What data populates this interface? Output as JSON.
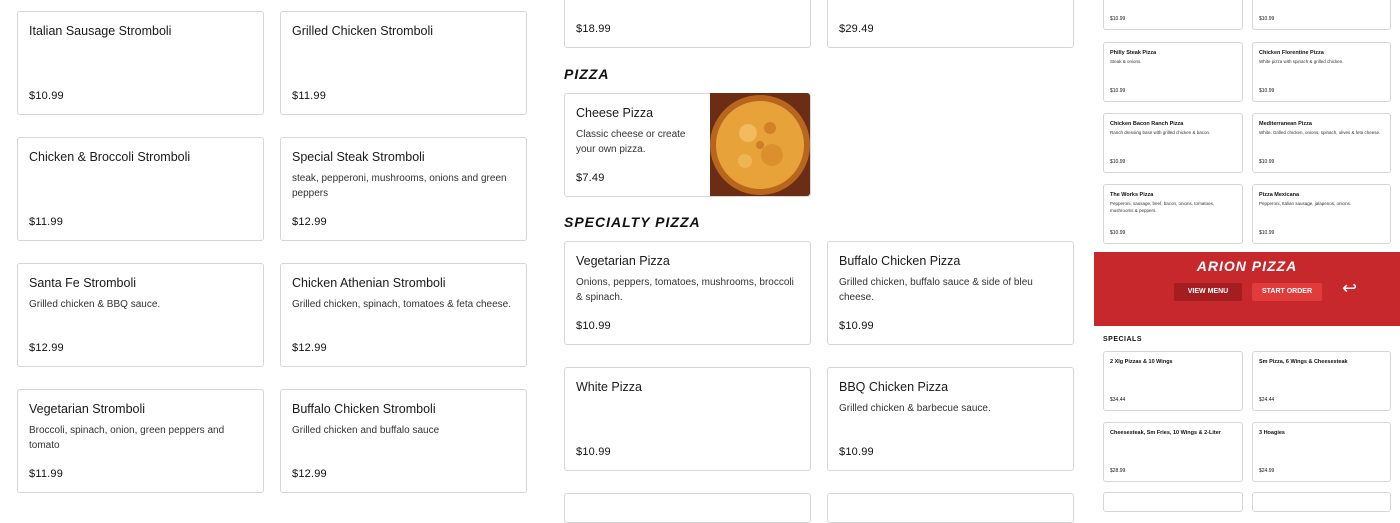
{
  "stromboli": [
    {
      "name": "Italian Sausage Stromboli",
      "desc": "",
      "price": "$10.99"
    },
    {
      "name": "Grilled Chicken Stromboli",
      "desc": "",
      "price": "$11.99"
    },
    {
      "name": "Chicken & Broccoli Stromboli",
      "desc": "",
      "price": "$11.99"
    },
    {
      "name": "Special Steak Stromboli",
      "desc": "steak, pepperoni, mushrooms, onions and green peppers",
      "price": "$12.99"
    },
    {
      "name": "Santa Fe Stromboli",
      "desc": "Grilled chicken & BBQ sauce.",
      "price": "$12.99"
    },
    {
      "name": "Chicken Athenian Stromboli",
      "desc": "Grilled chicken, spinach, tomatoes & feta cheese.",
      "price": "$12.99"
    },
    {
      "name": "Vegetarian Stromboli",
      "desc": "Broccoli, spinach, onion, green peppers and tomato",
      "price": "$11.99"
    },
    {
      "name": "Buffalo Chicken Stromboli",
      "desc": "Grilled chicken and buffalo sauce",
      "price": "$12.99"
    }
  ],
  "top_prices": [
    "$18.99",
    "$29.49"
  ],
  "pizza_section": {
    "title": "pizza",
    "cheese": {
      "name": "Cheese Pizza",
      "desc": "Classic cheese or create your own pizza.",
      "price": "$7.49",
      "image": "cheese-pizza-photo"
    }
  },
  "specialty_section": {
    "title": "specialty pizza",
    "items": [
      {
        "name": "Vegetarian Pizza",
        "desc": "Onions, peppers, tomatoes, mushrooms, broccoli & spinach.",
        "price": "$10.99"
      },
      {
        "name": "Buffalo Chicken Pizza",
        "desc": "Grilled chicken, buffalo sauce & side of bleu cheese.",
        "price": "$10.99"
      },
      {
        "name": "White Pizza",
        "desc": "",
        "price": "$10.99"
      },
      {
        "name": "BBQ Chicken Pizza",
        "desc": "Grilled chicken & barbecue sauce.",
        "price": "$10.99"
      }
    ]
  },
  "right_preview": {
    "top_prices": [
      "$10.99",
      "$10.99"
    ],
    "items": [
      {
        "name": "Philly Steak Pizza",
        "desc": "Steak & onions.",
        "price": "$10.99"
      },
      {
        "name": "Chicken Florentine Pizza",
        "desc": "White pizza with spinach & grilled chicken.",
        "price": "$10.99"
      },
      {
        "name": "Chicken Bacon Ranch Pizza",
        "desc": "Ranch dressing base with grilled chicken & bacon.",
        "price": "$10.99"
      },
      {
        "name": "Mediterranean Pizza",
        "desc": "White. Grilled chicken, onions, spinach, olives & feta cheese.",
        "price": "$10.99"
      },
      {
        "name": "The Works Pizza",
        "desc": "Pepperoni, sausage, beef, bacon, onions, tomatoes, mushrooms & peppers.",
        "price": "$10.99"
      },
      {
        "name": "Pizza Mexicana",
        "desc": "Pepperoni, Italian sausage, jalapenos, onions.",
        "price": "$10.99"
      }
    ],
    "banner": {
      "name": "ARION PIZZA",
      "view_menu": "VIEW MENU",
      "start_order": "START ORDER",
      "color": "#c6282b"
    },
    "specials_title": "SPECIALS",
    "specials": [
      {
        "name": "2 Xlg Pizzas & 10 Wings",
        "price": "$34.44"
      },
      {
        "name": "Sm Pizza, 6 Wings & Cheesesteak",
        "price": "$24.44"
      },
      {
        "name": "Cheesesteak, Sm Fries, 10 Wings & 2-Liter",
        "price": "$28.99"
      },
      {
        "name": "3 Hoagies",
        "price": "$24.99"
      }
    ]
  }
}
